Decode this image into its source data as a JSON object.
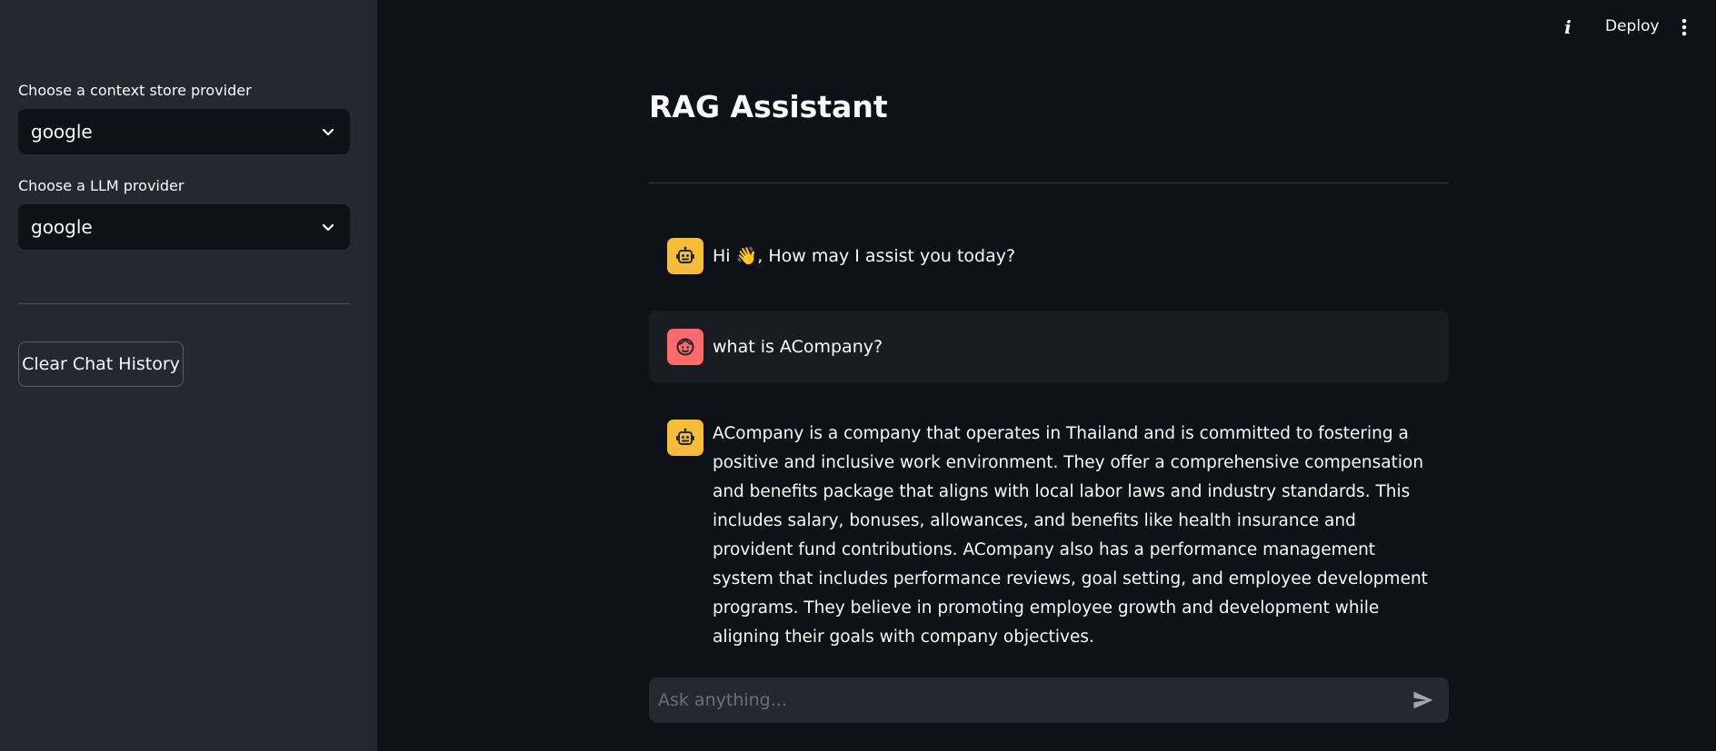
{
  "sidebar": {
    "context_label": "Choose a context store provider",
    "context_value": "google",
    "llm_label": "Choose a LLM provider",
    "llm_value": "google",
    "clear_button": "Clear Chat History"
  },
  "topbar": {
    "deploy_label": "Deploy"
  },
  "main": {
    "title": "RAG Assistant",
    "messages": [
      {
        "role": "assistant",
        "text": "Hi 👋, How may I assist you today?"
      },
      {
        "role": "user",
        "text": "what is ACompany?"
      },
      {
        "role": "assistant",
        "text": "ACompany is a company that operates in Thailand and is committed to fostering a positive and inclusive work environment. They offer a comprehensive compensation and benefits package that aligns with local labor laws and industry standards. This includes salary, bonuses, allowances, and benefits like health insurance and provident fund contributions. ACompany also has a performance management system that includes performance reviews, goal setting, and employee development programs. They believe in promoting employee growth and development while aligning their goals with company objectives."
      }
    ],
    "input_placeholder": "Ask anything..."
  },
  "colors": {
    "bot_avatar": "#f8bd38",
    "user_avatar": "#ff6b6b",
    "sidebar_bg": "#262730",
    "main_bg": "#0e1117"
  },
  "icons": {
    "bot": "robot-icon",
    "user": "face-icon",
    "select": "chevron-down-icon",
    "send": "send-icon",
    "menu": "vertical-dots-icon",
    "info": "info-icon"
  }
}
